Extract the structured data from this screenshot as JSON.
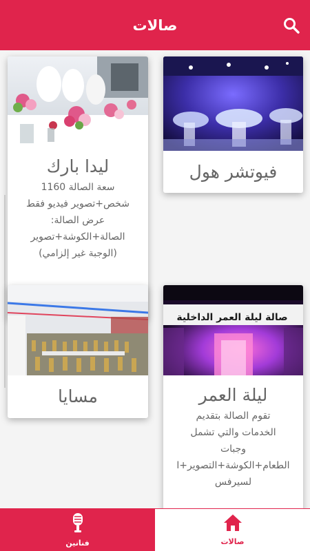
{
  "header": {
    "title": "صالات"
  },
  "halls": [
    {
      "name": "ليدا بارك",
      "desc_lines": [
        "سعة الصالة 1160",
        "شخص+تصوير فيديو فقط",
        "عرض الصالة:",
        "الصالة+الكوشة+تصوير",
        "(الوجبة غير إلزامي)"
      ]
    },
    {
      "name": "فيوتشر هول"
    },
    {
      "name": "مسايا"
    },
    {
      "name": "ليلة العمر",
      "photo_sign": "صالة ليلة العمر الداخلية",
      "desc_lines": [
        "تقوم الصالة بتقديم",
        "الخدمات والتي تشمل",
        "وجبات",
        "الطعام+الكوشة+التصوير+ا",
        "لسيرفس"
      ]
    }
  ],
  "bottom_nav": {
    "artists_label": "فنانين",
    "halls_label": "صالات"
  },
  "colors": {
    "brand": "#e0244c"
  }
}
